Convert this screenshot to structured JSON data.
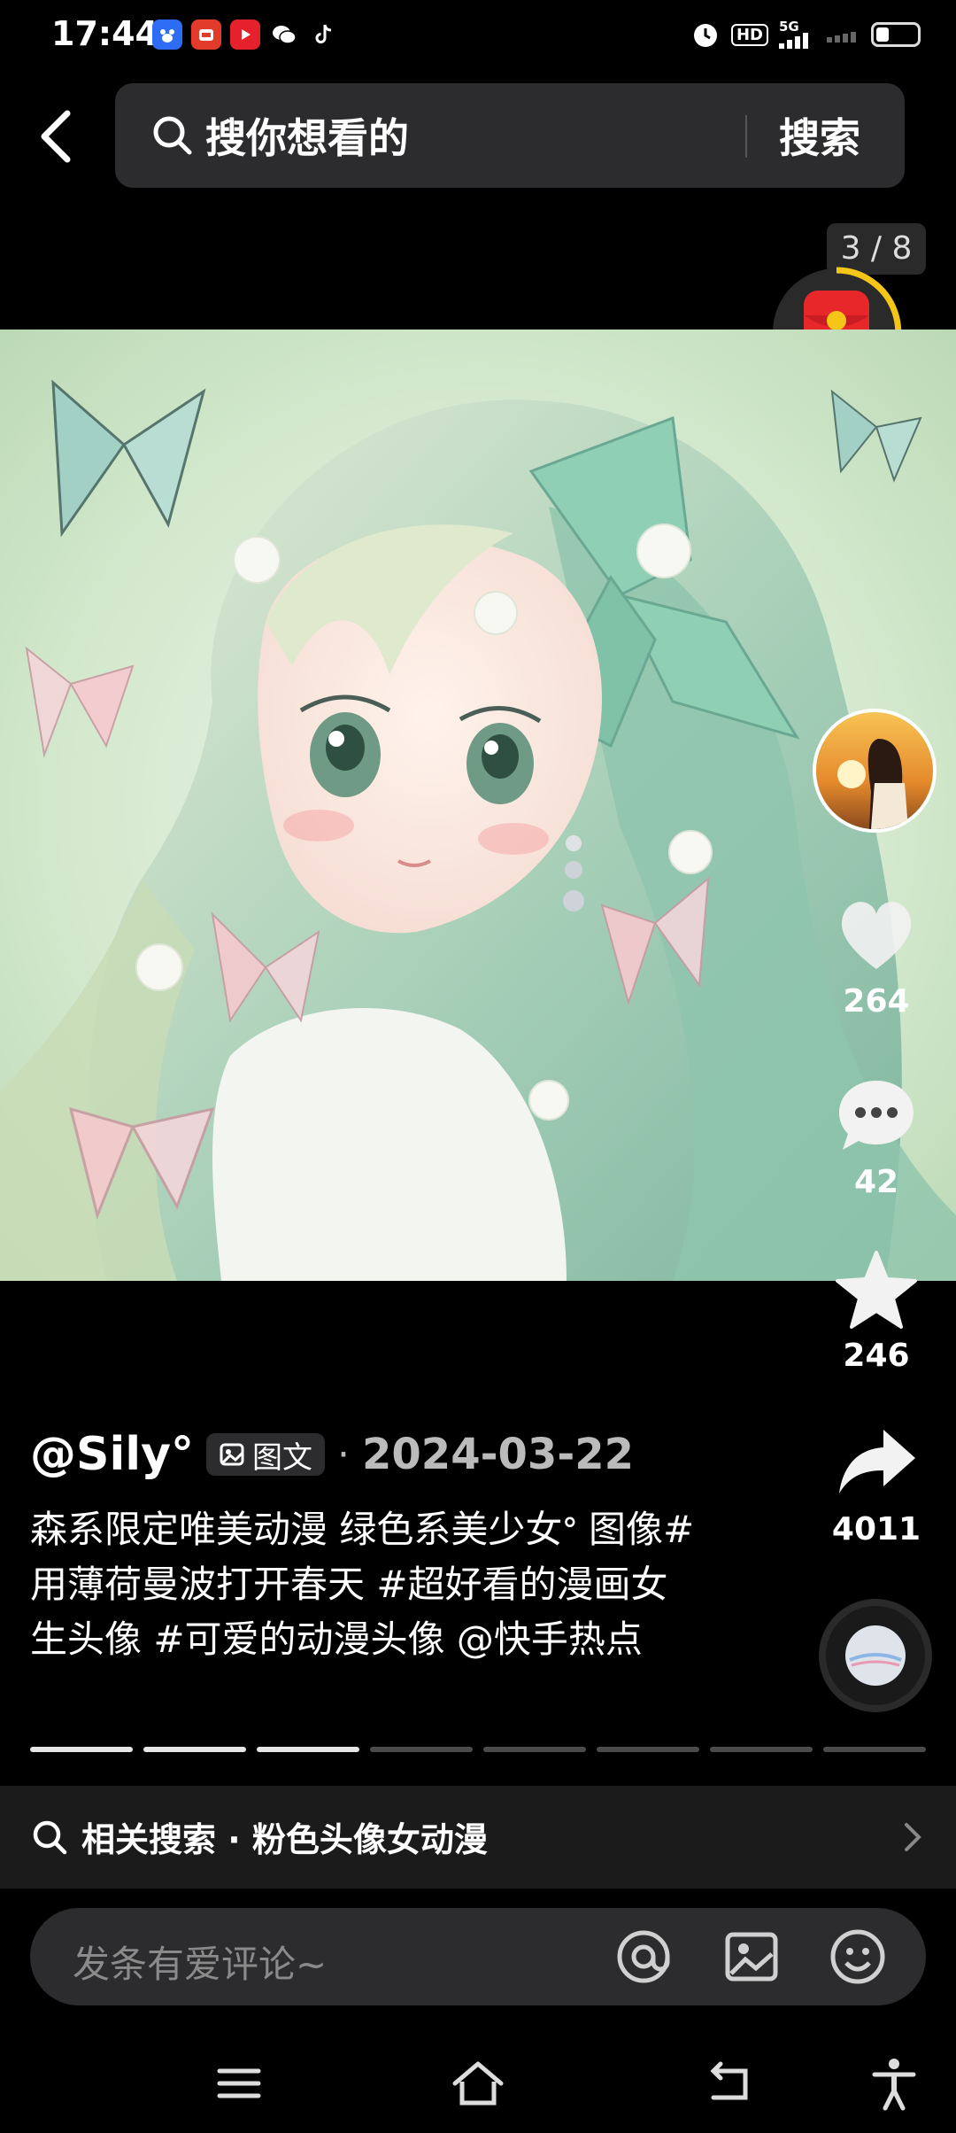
{
  "status_bar": {
    "time": "17:44",
    "apps": [
      {
        "icon": "baidu-app-icon",
        "color": "#2d6df6"
      },
      {
        "icon": "pinduoduo-app-icon",
        "color": "#e23b2b"
      },
      {
        "icon": "video-app-icon",
        "color": "#e5222b"
      },
      {
        "icon": "wechat-app-icon",
        "color": "#000000"
      },
      {
        "icon": "tiktok-app-icon",
        "color": "#000000"
      }
    ],
    "hd_label": "HD",
    "network_label": "5G"
  },
  "search": {
    "placeholder": "搜你想看的",
    "button_label": "搜索"
  },
  "page_indicator": "3 / 8",
  "rail": {
    "likes": "264",
    "comments": "42",
    "favorites": "246",
    "shares": "4011"
  },
  "post": {
    "author": "@Sily°",
    "type_label": "图文",
    "separator": "·",
    "date": "2024-03-22",
    "caption": "森系限定唯美动漫 绿色系美少女ᐤ 图像#用薄荷曼波打开春天 #超好看的漫画女生头像 #可爱的动漫头像 @快手热点"
  },
  "progress": {
    "current": 3,
    "total": 8
  },
  "related_search": {
    "text": "相关搜索 · 粉色头像女动漫"
  },
  "comment": {
    "placeholder": "发条有爱评论~"
  },
  "colors": {
    "background": "#000000",
    "surface": "#2c2c2e",
    "accent_gold": "#f5c518",
    "red_packet": "#e8272b",
    "mint": "#a8d8c0"
  }
}
